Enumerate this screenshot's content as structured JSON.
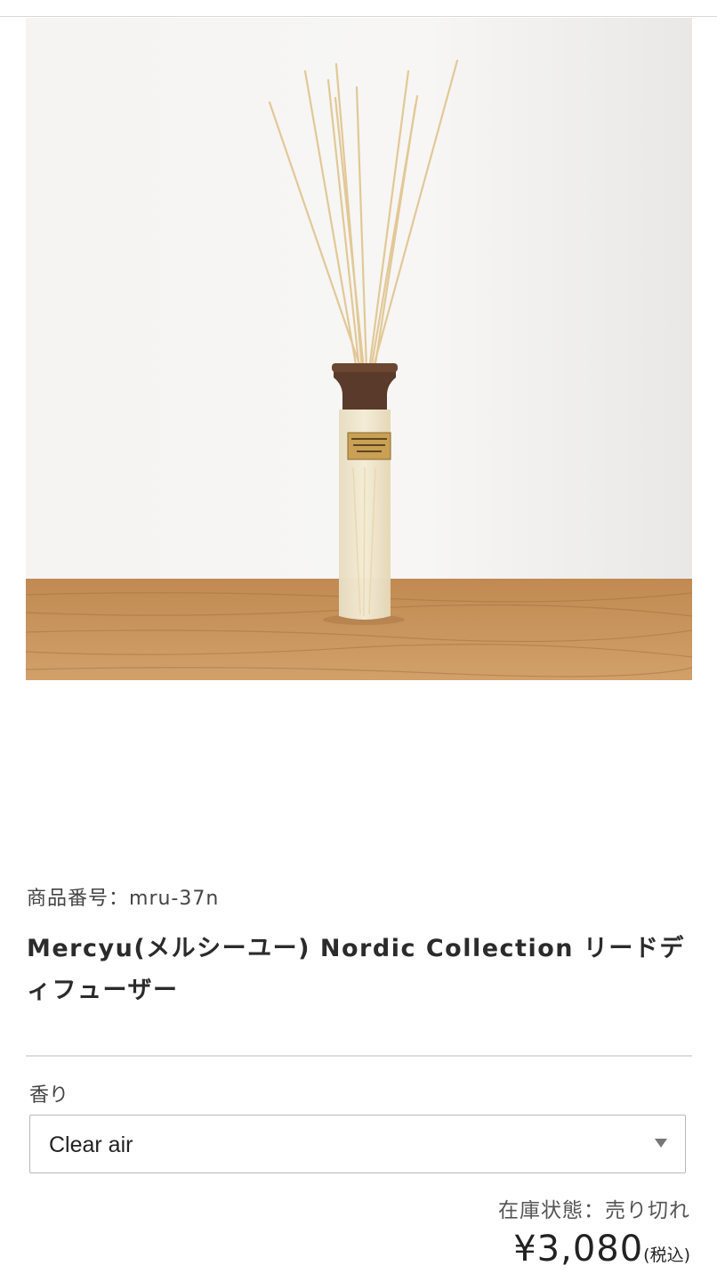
{
  "product": {
    "image_alt": "Mercyu Nordic Collection reed diffuser with wooden cap on a wooden table",
    "sku_label": "商品番号：",
    "sku_value": "mru-37n",
    "title": "Mercyu(メルシーユー) Nordic Collection リードディフューザー",
    "variant_label": "香り",
    "variant_selected": "Clear air",
    "stock_status": "在庫状態：売り切れ",
    "price": "¥3,080",
    "tax_note": "(税込)"
  },
  "colors": {
    "wall": "#f6f5f3",
    "table": "#c8935d",
    "bottle": "#efe6cf",
    "cap": "#5a3a2a",
    "reed": "#e7cfa3"
  }
}
